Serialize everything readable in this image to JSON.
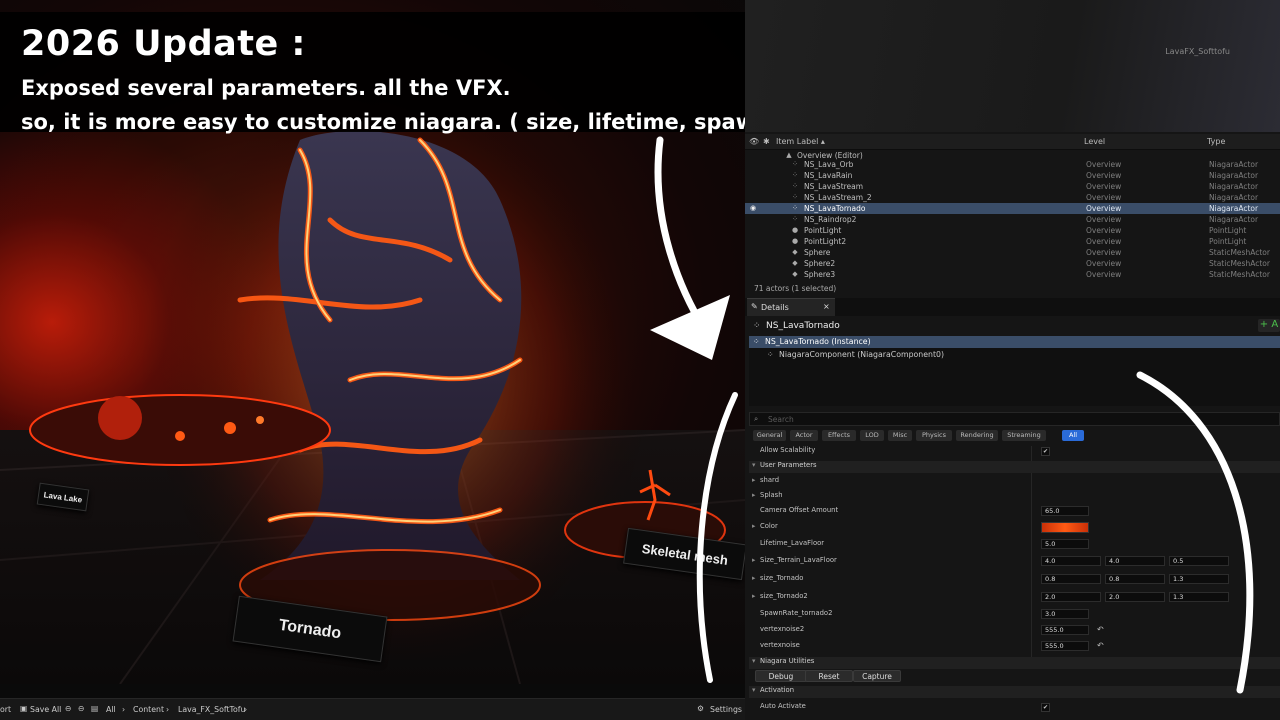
{
  "caption": {
    "title": "2026 Update :",
    "line1": "Exposed several parameters. all the VFX.",
    "line2": "so, it is more easy to customize niagara.  ( size, lifetime, spawn count, color, velocity, noise, ,, etc)"
  },
  "viewport": {
    "labels": {
      "lava_lake": "Lava Lake",
      "tornado": "Tornado",
      "skeletal": "Skeletal mesh"
    }
  },
  "editor": {
    "window_title": "LavaFX_Softtofu",
    "outliner": {
      "headers": {
        "label": "Item Label ▴",
        "level": "Level",
        "type": "Type"
      },
      "rows": [
        {
          "label": "Overview (Editor)",
          "level": "",
          "type": ""
        },
        {
          "label": "NS_Lava_Orb",
          "level": "Overview",
          "type": "NiagaraActor"
        },
        {
          "label": "NS_LavaRain",
          "level": "Overview",
          "type": "NiagaraActor"
        },
        {
          "label": "NS_LavaStream",
          "level": "Overview",
          "type": "NiagaraActor"
        },
        {
          "label": "NS_LavaStream_2",
          "level": "Overview",
          "type": "NiagaraActor"
        },
        {
          "label": "NS_LavaTornado",
          "level": "Overview",
          "type": "NiagaraActor"
        },
        {
          "label": "NS_Raindrop2",
          "level": "Overview",
          "type": "NiagaraActor"
        },
        {
          "label": "PointLight",
          "level": "Overview",
          "type": "PointLight"
        },
        {
          "label": "PointLight2",
          "level": "Overview",
          "type": "PointLight"
        },
        {
          "label": "Sphere",
          "level": "Overview",
          "type": "StaticMeshActor"
        },
        {
          "label": "Sphere2",
          "level": "Overview",
          "type": "StaticMeshActor"
        },
        {
          "label": "Sphere3",
          "level": "Overview",
          "type": "StaticMeshActor"
        }
      ],
      "count": "71 actors (1 selected)"
    },
    "details": {
      "tab": "Details",
      "close": "×",
      "object_name": "NS_LavaTornado",
      "add": "+ A",
      "components": [
        "NS_LavaTornado (Instance)",
        "NiagaraComponent (NiagaraComponent0)"
      ],
      "search_placeholder": "Search",
      "filters": [
        "General",
        "Actor",
        "Effects",
        "LOD",
        "Misc",
        "Physics",
        "Rendering",
        "Streaming",
        "All"
      ],
      "allow_scalability": "Allow Scalability",
      "user_parameters": "User Parameters",
      "params": {
        "shard": "shard",
        "splash": "Splash",
        "camera_offset": {
          "label": "Camera Offset Amount",
          "value": "65.0"
        },
        "color": {
          "label": "Color",
          "value": "#e8400f"
        },
        "lifetime_lavafloor": {
          "label": "Lifetime_LavaFloor",
          "value": "5.0"
        },
        "size_terrain": {
          "label": "Size_Terrain_LavaFloor",
          "x": "4.0",
          "y": "4.0",
          "z": "0.5"
        },
        "size_tornado": {
          "label": "size_Tornado",
          "x": "0.8",
          "y": "0.8",
          "z": "1.3"
        },
        "size_tornado2": {
          "label": "size_Tornado2",
          "x": "2.0",
          "y": "2.0",
          "z": "1.3"
        },
        "spawnrate": {
          "label": "SpawnRate_tornado2",
          "value": "3.0"
        },
        "vertexnoise2": {
          "label": "vertexnoise2",
          "value": "555.0"
        },
        "vertexnoise": {
          "label": "vertexnoise",
          "value": "555.0"
        }
      },
      "niagara_utilities": "Niagara Utilities",
      "utility_buttons": [
        "Debug",
        "Reset",
        "Capture"
      ],
      "activation": "Activation",
      "auto_activate": "Auto Activate"
    }
  },
  "bottombar": {
    "left": "ort",
    "save_all": "Save All",
    "crumbs": [
      "All",
      "Content",
      "Lava_FX_SoftTofu"
    ],
    "settings": "Settings"
  },
  "colors": {
    "accent": "#2a6bd8",
    "selection": "#3a4d68",
    "lava": "#ff5a14"
  }
}
